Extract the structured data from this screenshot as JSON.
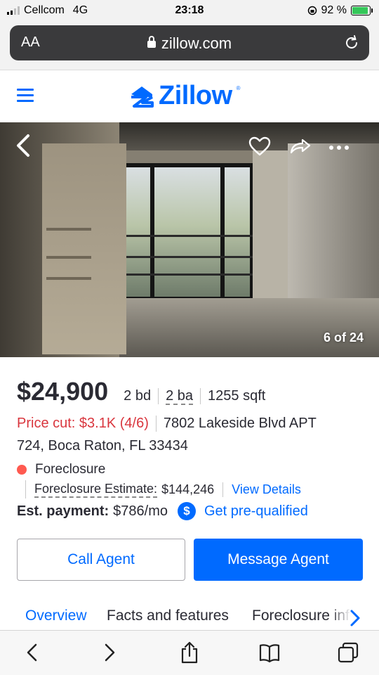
{
  "status_bar": {
    "carrier": "Cellcom",
    "network": "4G",
    "time": "23:18",
    "battery": "92 %",
    "battery_level": 0.92
  },
  "browser": {
    "text_size_label": "AA",
    "domain": "zillow.com"
  },
  "site": {
    "brand": "Zillow",
    "brand_color": "#006aff"
  },
  "gallery": {
    "counter": "6 of 24"
  },
  "listing": {
    "price": "$24,900",
    "beds": "2 bd",
    "baths": "2 ba",
    "sqft": "1255 sqft",
    "price_cut": "Price cut: $3.1K (4/6)",
    "address_line1": "7802 Lakeside Blvd APT",
    "address_line2": "724, Boca Raton, FL 33434",
    "status": "Foreclosure",
    "status_color": "#ff5a50",
    "estimate_label": "Foreclosure Estimate:",
    "estimate_value": "$144,246",
    "view_details": "View Details",
    "payment_label": "Est. payment:",
    "payment_value": "$786/mo",
    "prequalified": "Get pre-qualified"
  },
  "actions": {
    "call_agent": "Call Agent",
    "message_agent": "Message Agent"
  },
  "tabs": [
    {
      "label": "Overview"
    },
    {
      "label": "Facts and features"
    },
    {
      "label": "Foreclosure info"
    }
  ]
}
